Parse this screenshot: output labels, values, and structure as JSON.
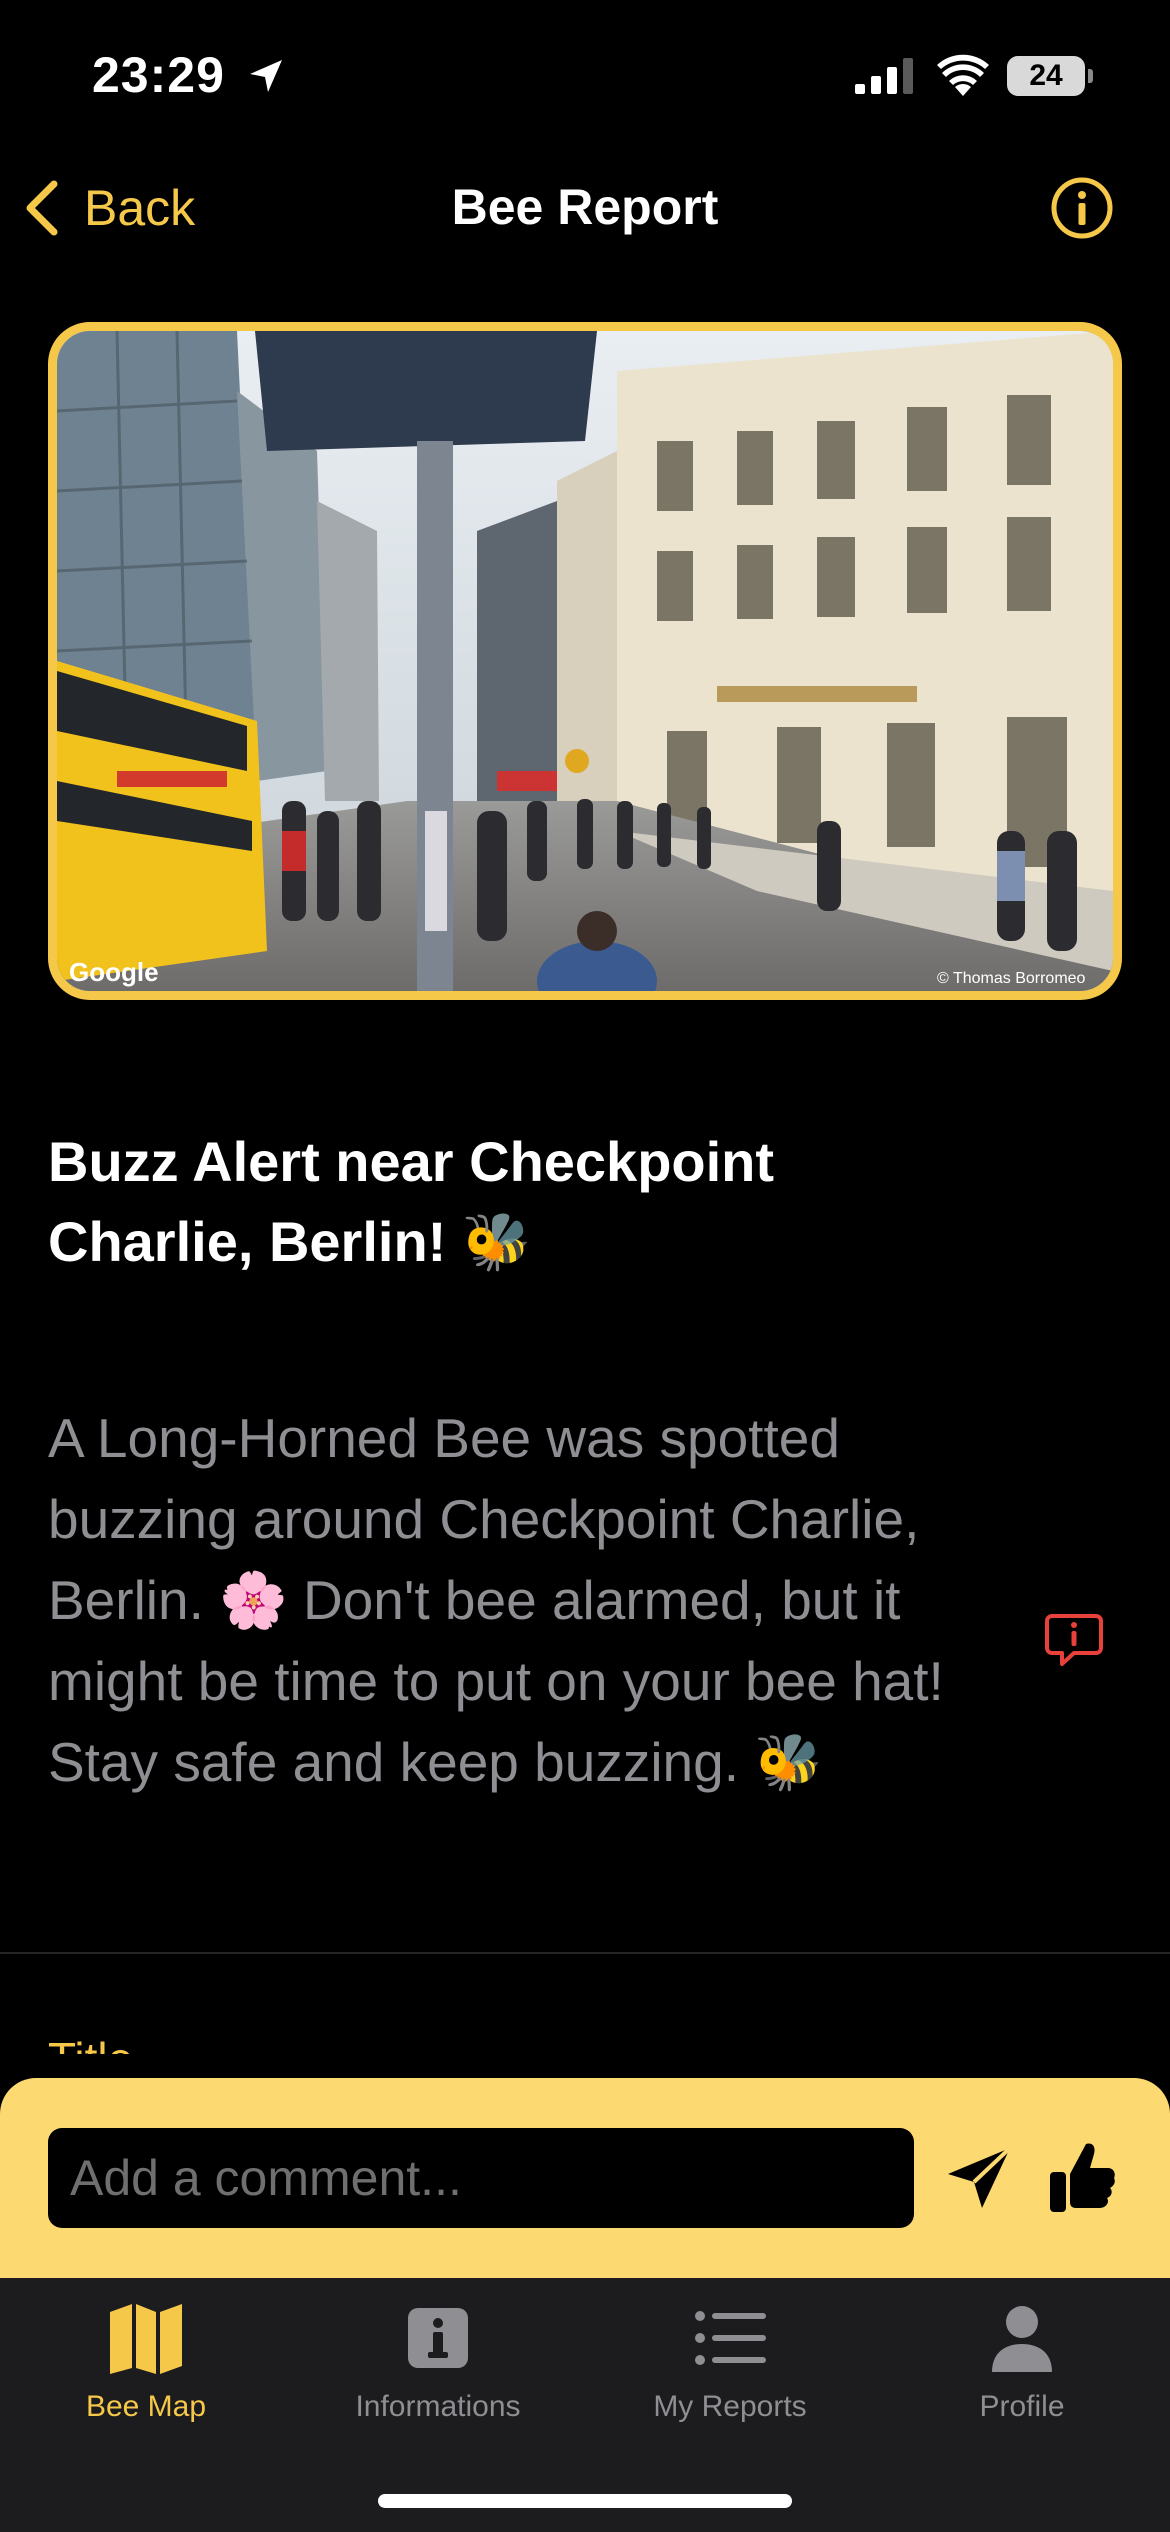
{
  "status_bar": {
    "time": "23:29",
    "battery": "24",
    "icons": [
      "location-arrow-icon",
      "signal-icon",
      "wifi-icon",
      "battery-icon"
    ]
  },
  "nav": {
    "back_label": "Back",
    "title": "Bee Report",
    "info_icon": "info-circle-icon"
  },
  "photo": {
    "watermark_left": "Google",
    "watermark_right": "© Thomas Borromeo"
  },
  "report": {
    "headline": "Buzz Alert near Checkpoint Charlie, Berlin! 🐝",
    "description": "A Long-Horned Bee was spotted buzzing around Checkpoint Charlie, Berlin. 🌸 Don't bee alarmed, but it might be time to put on your bee hat! Stay safe and keep buzzing. 🐝",
    "section_label": "Title"
  },
  "comment": {
    "placeholder": "Add a comment...",
    "value": ""
  },
  "tabs": [
    {
      "label": "Bee Map",
      "icon": "map-icon",
      "active": true
    },
    {
      "label": "Informations",
      "icon": "info-square-icon",
      "active": false
    },
    {
      "label": "My Reports",
      "icon": "list-icon",
      "active": false
    },
    {
      "label": "Profile",
      "icon": "person-icon",
      "active": false
    }
  ],
  "colors": {
    "accent": "#f6c84a",
    "comment_bar": "#fcd971",
    "background": "#000000",
    "tab_bar": "#1c1c1e",
    "muted_text": "#8e8e93",
    "alert_red": "#e8403a"
  }
}
